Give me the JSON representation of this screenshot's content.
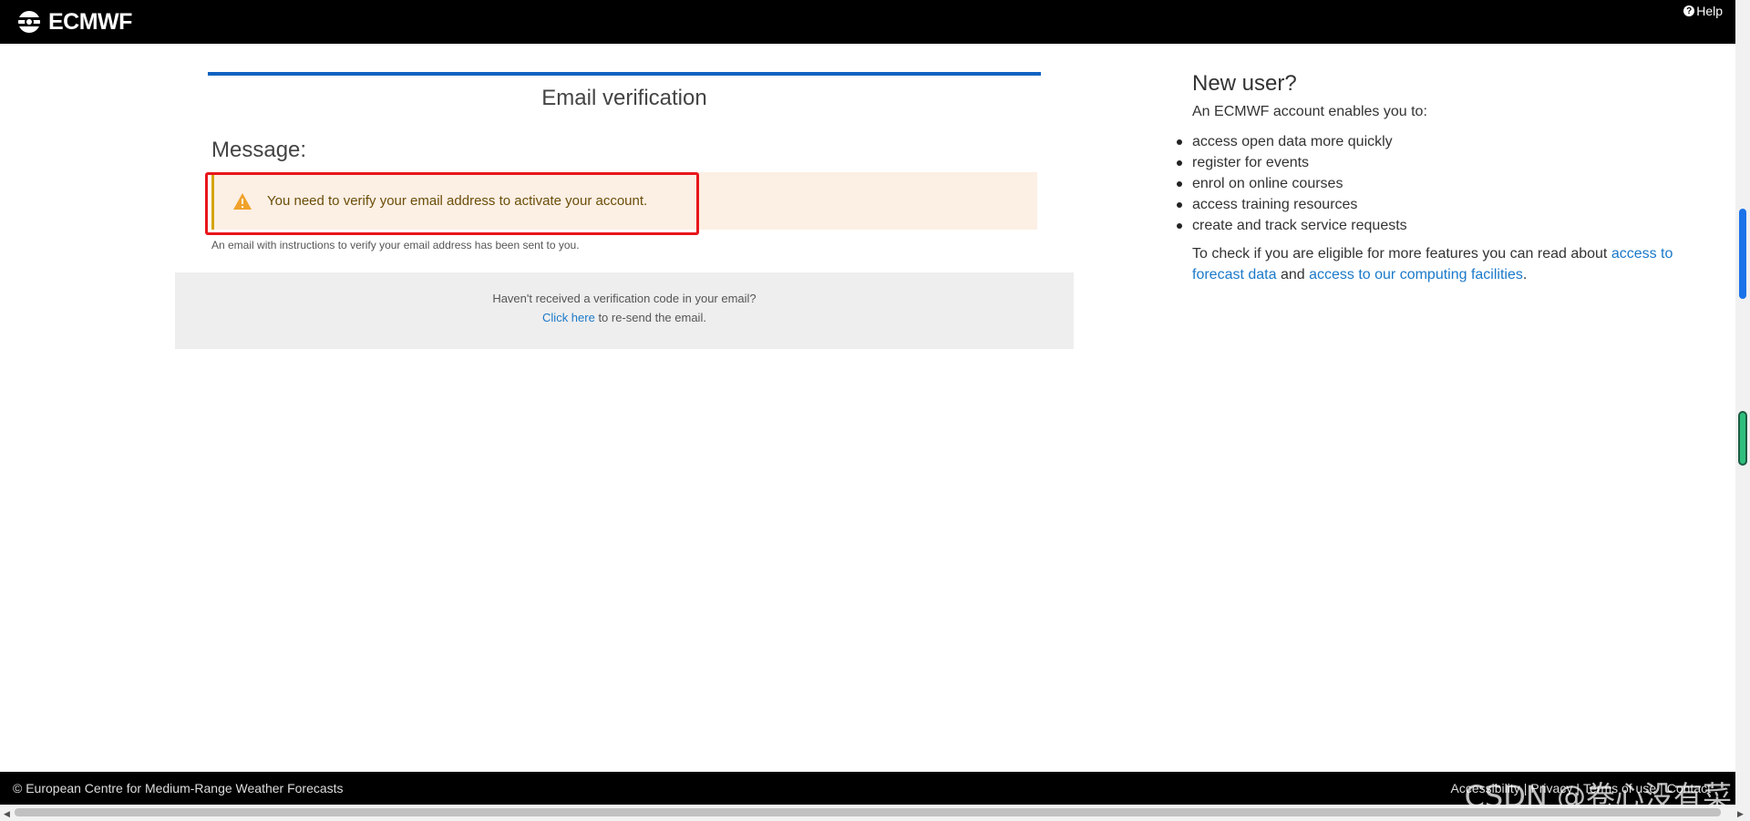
{
  "header": {
    "logo_text": "ECMWF",
    "help_label": "Help",
    "help_icon": "question-circle-icon"
  },
  "main": {
    "title": "Email verification",
    "message_heading": "Message:",
    "alert": {
      "text": "You need to verify your email address to activate your account.",
      "icon": "warning-triangle-icon",
      "color": "#fcefe4",
      "accent": "#d4a40b"
    },
    "sent_note": "An email with instructions to verify your email address has been sent to you.",
    "resend": {
      "question": "Haven't received a verification code in your email?",
      "link_label": "Click here",
      "after_link": " to re-send the email."
    }
  },
  "sidebar": {
    "title": "New user?",
    "intro": "An ECMWF account enables you to:",
    "features": [
      "access open data more quickly",
      "register for events",
      "enrol on online courses",
      "access training resources",
      "create and track service requests"
    ],
    "more_prefix": "To check if you are eligible for more features you can read about ",
    "link1": "access to forecast data",
    "more_middle": " and ",
    "link2": "access to our computing facilities",
    "more_suffix": "."
  },
  "footer": {
    "copyright": "© European Centre for Medium-Range Weather Forecasts",
    "links": [
      "Accessibility",
      "Privacy",
      "Terms of use",
      "Contact"
    ],
    "watermark": "CSDN @卷心没有菜"
  },
  "colors": {
    "brand_bar": "#000000",
    "accent_blue": "#0f62c2",
    "link": "#1b79c9",
    "highlight": "#e8161b"
  }
}
